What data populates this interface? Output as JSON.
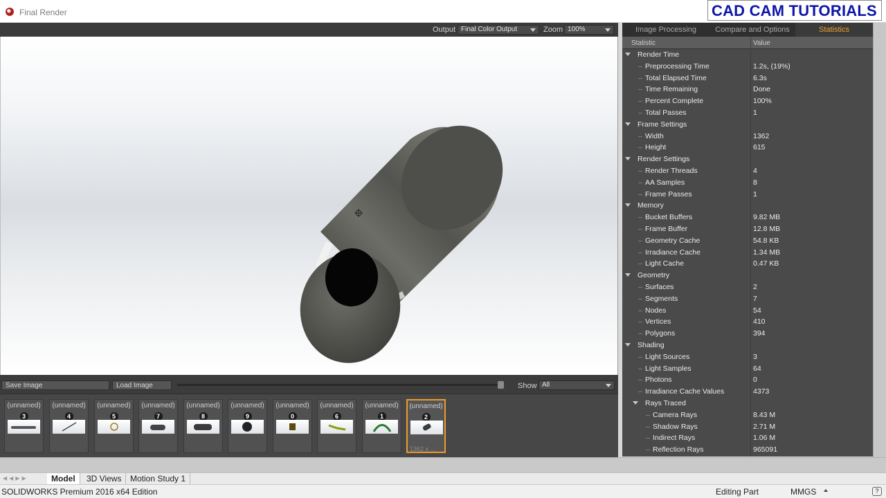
{
  "window": {
    "title": "Final Render",
    "brand": "CAD CAM TUTORIALS"
  },
  "toolbar": {
    "output_label": "Output",
    "output_value": "Final Color Output",
    "zoom_label": "Zoom",
    "zoom_value": "100%"
  },
  "image_bar": {
    "save_label": "Save Image",
    "load_label": "Load Image",
    "show_label": "Show",
    "show_value": "All"
  },
  "thumbnails": [
    {
      "label": "(unnamed)",
      "num": "3"
    },
    {
      "label": "(unnamed)",
      "num": "4"
    },
    {
      "label": "(unnamed)",
      "num": "5"
    },
    {
      "label": "(unnamed)",
      "num": "7"
    },
    {
      "label": "(unnamed)",
      "num": "8"
    },
    {
      "label": "(unnamed)",
      "num": "9"
    },
    {
      "label": "(unnamed)",
      "num": "0"
    },
    {
      "label": "(unnamed)",
      "num": "6"
    },
    {
      "label": "(unnamed)",
      "num": "1"
    },
    {
      "label": "(unnamed)",
      "num": "2",
      "selected": true,
      "dims": "1362 x ..."
    }
  ],
  "panel": {
    "tabs": [
      "Image Processing",
      "Compare and Options",
      "Statistics"
    ],
    "active_tab": "Statistics",
    "header": {
      "statistic": "Statistic",
      "value": "Value"
    },
    "rows": [
      {
        "k": "Render Time",
        "v": "",
        "level": 0
      },
      {
        "k": "Preprocessing Time",
        "v": "1.2s, (19%)",
        "level": 1
      },
      {
        "k": "Total Elapsed Time",
        "v": "6.3s",
        "level": 1
      },
      {
        "k": "Time Remaining",
        "v": "Done",
        "level": 1
      },
      {
        "k": "Percent Complete",
        "v": "100%",
        "level": 1
      },
      {
        "k": "Total Passes",
        "v": "1",
        "level": 1
      },
      {
        "k": "Frame Settings",
        "v": "",
        "level": 0
      },
      {
        "k": "Width",
        "v": "1362",
        "level": 1
      },
      {
        "k": "Height",
        "v": "615",
        "level": 1
      },
      {
        "k": "Render Settings",
        "v": "",
        "level": 0
      },
      {
        "k": "Render Threads",
        "v": "4",
        "level": 1
      },
      {
        "k": "AA Samples",
        "v": "8",
        "level": 1
      },
      {
        "k": "Frame Passes",
        "v": "1",
        "level": 1
      },
      {
        "k": "Memory",
        "v": "",
        "level": 0
      },
      {
        "k": "Bucket Buffers",
        "v": "9.82 MB",
        "level": 1
      },
      {
        "k": "Frame Buffer",
        "v": "12.8 MB",
        "level": 1
      },
      {
        "k": "Geometry Cache",
        "v": "54.8 KB",
        "level": 1
      },
      {
        "k": "Irradiance Cache",
        "v": "1.34 MB",
        "level": 1
      },
      {
        "k": "Light Cache",
        "v": "0.47 KB",
        "level": 1
      },
      {
        "k": "Geometry",
        "v": "",
        "level": 0
      },
      {
        "k": "Surfaces",
        "v": "2",
        "level": 1
      },
      {
        "k": "Segments",
        "v": "7",
        "level": 1
      },
      {
        "k": "Nodes",
        "v": "54",
        "level": 1
      },
      {
        "k": "Vertices",
        "v": "410",
        "level": 1
      },
      {
        "k": "Polygons",
        "v": "394",
        "level": 1
      },
      {
        "k": "Shading",
        "v": "",
        "level": 0
      },
      {
        "k": "Light Sources",
        "v": "3",
        "level": 1
      },
      {
        "k": "Light Samples",
        "v": "64",
        "level": 1
      },
      {
        "k": "Photons",
        "v": "0",
        "level": 1
      },
      {
        "k": "Irradiance Cache Values",
        "v": "4373",
        "level": 1
      },
      {
        "k": "Rays Traced",
        "v": "",
        "level": 1,
        "group": true
      },
      {
        "k": "Camera Rays",
        "v": "8.43 M",
        "level": 2
      },
      {
        "k": "Shadow Rays",
        "v": "2.71 M",
        "level": 2
      },
      {
        "k": "Indirect Rays",
        "v": "1.06 M",
        "level": 2
      },
      {
        "k": "Reflection Rays",
        "v": "965091",
        "level": 2
      }
    ]
  },
  "model_tabs": [
    "Model",
    "3D Views",
    "Motion Study 1"
  ],
  "active_model_tab": "Model",
  "status": {
    "left": "SOLIDWORKS Premium 2016 x64 Edition",
    "mode": "Editing Part",
    "units": "MMGS"
  },
  "colors": {
    "accent": "#f09a2a",
    "brand_text": "#0d16a8"
  }
}
